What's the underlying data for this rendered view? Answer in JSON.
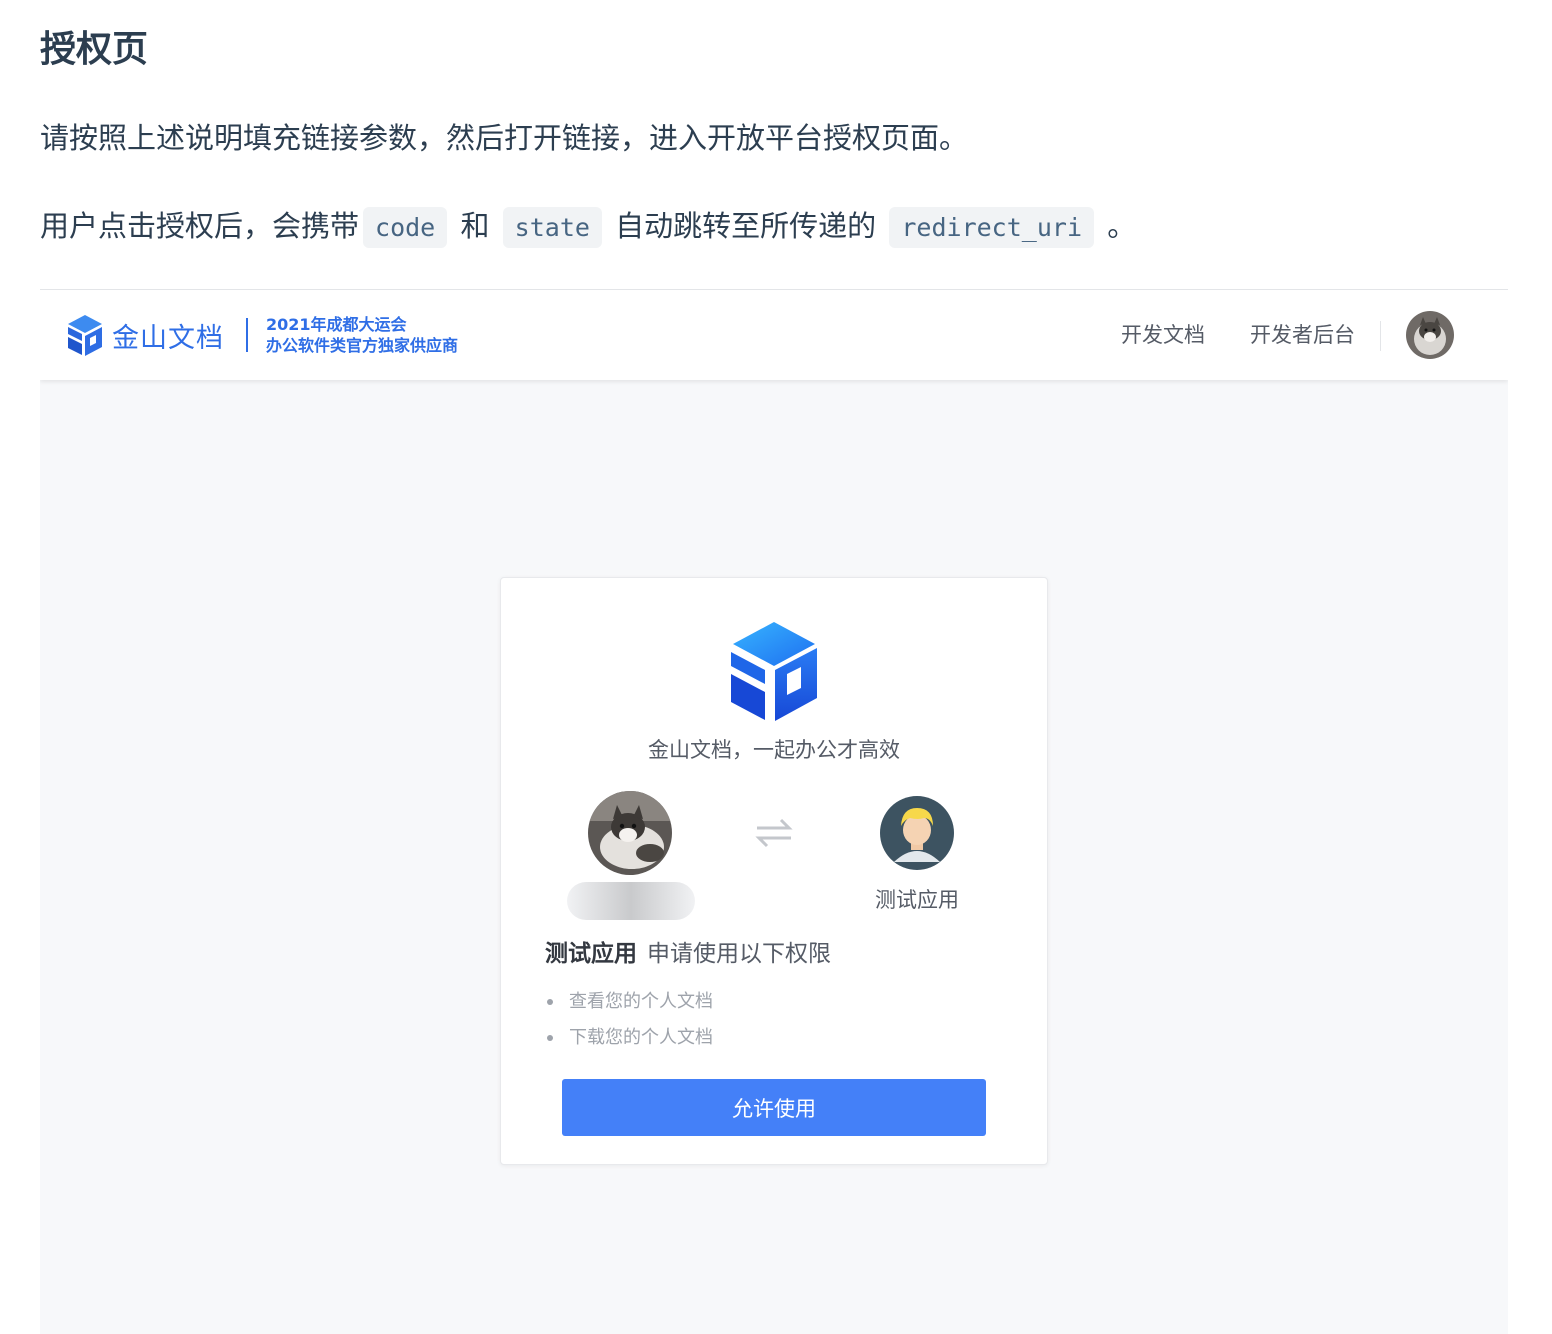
{
  "doc": {
    "title": "授权页",
    "para1": "请按照上述说明填充链接参数，然后打开链接，进入开放平台授权页面。",
    "para2": {
      "prefix": "用户点击授权后，会携带",
      "code1": "code",
      "and": " 和 ",
      "code2": "state",
      "middle": " 自动跳转至所传递的 ",
      "code3": "redirect_uri",
      "suffix": " 。"
    }
  },
  "screenshot": {
    "brand": {
      "logo_icon": "wps-cube-logo",
      "name": "金山文档",
      "slogan_line1": "2021年成都大运会",
      "slogan_line2": "办公软件类官方独家供应商"
    },
    "nav": {
      "docs": "开发文档",
      "console": "开发者后台",
      "avatar_icon": "user-avatar-cat"
    },
    "card": {
      "logo_icon": "wps-cube-logo",
      "slogan": "金山文档，一起办公才高效",
      "user_avatar_icon": "user-avatar-cat",
      "swap_icon": "swap-arrows-icon",
      "app_avatar_icon": "app-avatar-person",
      "app_name": "测试应用",
      "request_app": "测试应用",
      "request_text": "申请使用以下权限",
      "permissions": [
        "查看您的个人文档",
        "下载您的个人文档"
      ],
      "allow_button": "允许使用"
    },
    "colors": {
      "brand_blue": "#2f6ee6",
      "button_blue": "#4480f8",
      "page_bg": "#f7f8fa"
    }
  }
}
